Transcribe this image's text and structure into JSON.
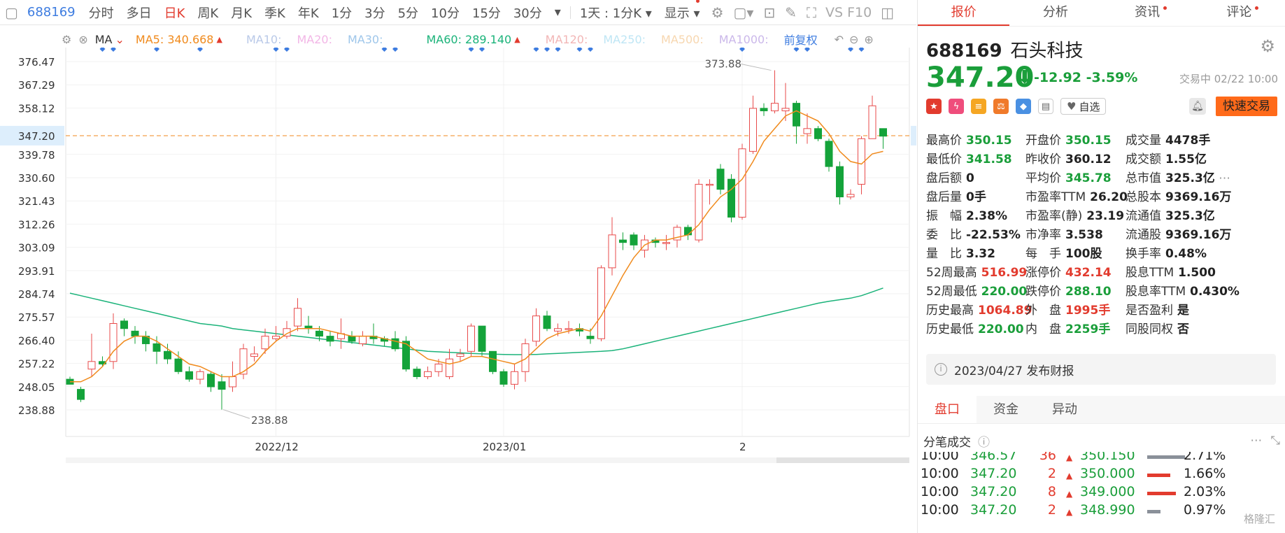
{
  "toolbar": {
    "code": "688169",
    "items": [
      "分时",
      "多日",
      "日K",
      "周K",
      "月K",
      "季K",
      "年K",
      "1分",
      "3分",
      "5分",
      "10分",
      "15分",
      "30分"
    ],
    "active": "日K",
    "range": "1天 : 1分K",
    "display": "显示",
    "vsf": "VS F10"
  },
  "ma": {
    "label": "MA",
    "ma5": "MA5: 340.668",
    "ma10": "MA10:",
    "ma20": "MA20:",
    "ma30": "MA30:",
    "ma60": "MA60: 289.140",
    "ma120": "MA120:",
    "ma250": "MA250:",
    "ma500": "MA500:",
    "ma1000": "MA1000:",
    "adjust": "前复权",
    "colors": {
      "ma5": "#f08a1c",
      "ma60": "#1bb37a",
      "faded": "#b9c9e8",
      "faded_red": "#f2b6b6"
    }
  },
  "chart_data": {
    "type": "candlestick",
    "y_ticks": [
      "376.47",
      "367.29",
      "358.12",
      "347.20",
      "339.78",
      "330.60",
      "321.43",
      "312.26",
      "303.09",
      "293.91",
      "284.74",
      "275.57",
      "266.40",
      "257.22",
      "248.05",
      "238.88"
    ],
    "current_price": "347.20",
    "x_labels": [
      "2022/12",
      "2023/01",
      "2"
    ],
    "high_label": "373.88",
    "low_label": "238.88",
    "candles": [
      [
        251,
        249,
        252,
        249
      ],
      [
        247,
        243,
        248,
        242
      ],
      [
        255,
        258,
        269,
        252
      ],
      [
        258,
        257,
        260,
        256
      ],
      [
        258,
        273,
        277,
        255
      ],
      [
        274,
        271,
        275,
        268
      ],
      [
        270,
        268,
        272,
        265
      ],
      [
        268,
        265,
        270,
        262
      ],
      [
        265,
        262,
        268,
        257
      ],
      [
        262,
        259,
        265,
        257
      ],
      [
        259,
        254,
        262,
        253
      ],
      [
        254,
        251,
        256,
        250
      ],
      [
        251,
        254,
        255,
        249
      ],
      [
        253,
        248,
        254,
        246
      ],
      [
        250,
        247,
        253,
        239
      ],
      [
        248,
        252,
        258,
        246
      ],
      [
        253,
        263,
        265,
        251
      ],
      [
        260,
        261,
        264,
        258
      ],
      [
        263,
        268,
        271,
        261
      ],
      [
        267,
        268,
        272,
        266
      ],
      [
        268,
        271,
        274,
        267
      ],
      [
        272,
        279,
        283,
        270
      ],
      [
        272,
        271,
        276,
        269
      ],
      [
        270,
        268,
        272,
        266
      ],
      [
        268,
        266,
        270,
        264
      ],
      [
        267,
        269,
        275,
        263
      ],
      [
        268,
        266,
        270,
        265
      ],
      [
        265,
        268,
        270,
        264
      ],
      [
        268,
        267,
        273,
        265
      ],
      [
        267,
        266,
        268,
        264
      ],
      [
        267,
        263,
        270,
        262
      ],
      [
        266,
        255,
        268,
        254
      ],
      [
        255,
        252,
        256,
        251
      ],
      [
        252,
        254,
        256,
        251
      ],
      [
        254,
        257,
        259,
        252
      ],
      [
        252,
        259,
        263,
        251
      ],
      [
        260,
        261,
        263,
        258
      ],
      [
        262,
        272,
        273,
        260
      ],
      [
        272,
        262,
        272,
        260
      ],
      [
        262,
        254,
        262,
        253
      ],
      [
        254,
        249,
        255,
        248
      ],
      [
        249,
        254,
        257,
        247
      ],
      [
        254,
        265,
        267,
        250
      ],
      [
        266,
        276,
        279,
        264
      ],
      [
        276,
        271,
        278,
        270
      ],
      [
        270,
        271,
        273,
        268
      ],
      [
        271,
        271,
        274,
        269
      ],
      [
        271,
        270,
        273,
        268
      ],
      [
        268,
        267,
        271,
        265
      ],
      [
        267,
        295,
        296,
        266
      ],
      [
        295,
        308,
        315,
        292
      ],
      [
        306,
        305,
        309,
        302
      ],
      [
        308,
        304,
        309,
        302
      ],
      [
        302,
        306,
        308,
        299
      ],
      [
        306,
        305,
        307,
        303
      ],
      [
        305,
        305,
        308,
        302
      ],
      [
        306,
        311,
        312,
        303
      ],
      [
        311,
        308,
        312,
        306
      ],
      [
        306,
        328,
        330,
        305
      ],
      [
        328,
        328,
        330,
        320
      ],
      [
        334,
        326,
        336,
        324
      ],
      [
        330,
        315,
        332,
        313
      ],
      [
        315,
        342,
        344,
        314
      ],
      [
        341,
        358,
        363,
        340
      ],
      [
        358,
        357,
        360,
        355
      ],
      [
        357,
        360,
        373,
        356
      ],
      [
        357,
        358,
        368,
        353
      ],
      [
        360,
        351,
        361,
        344
      ],
      [
        348,
        350,
        356,
        344
      ],
      [
        350,
        346,
        351,
        345
      ],
      [
        345,
        335,
        346,
        333
      ],
      [
        335,
        323,
        337,
        320
      ],
      [
        323,
        324,
        326,
        322
      ],
      [
        328,
        346,
        347,
        324
      ],
      [
        346,
        359,
        363,
        346
      ],
      [
        350,
        347,
        350,
        342
      ]
    ],
    "ma5": [
      250,
      250,
      252,
      256,
      262,
      266,
      268,
      268,
      266,
      263,
      260,
      257,
      256,
      254,
      252,
      252,
      254,
      257,
      262,
      266,
      269,
      271,
      271,
      271,
      270,
      269,
      268,
      268,
      268,
      267,
      266,
      265,
      262,
      259,
      258,
      257,
      258,
      260,
      260,
      259,
      258,
      257,
      259,
      263,
      267,
      269,
      270,
      271,
      270,
      276,
      284,
      292,
      299,
      304,
      306,
      306,
      307,
      308,
      312,
      318,
      323,
      326,
      330,
      337,
      345,
      350,
      355,
      357,
      355,
      353,
      348,
      341,
      337,
      336,
      340,
      341
    ],
    "ma60": [
      285,
      284,
      283,
      282,
      281,
      280,
      279,
      278,
      277,
      276,
      275,
      274,
      273,
      272.5,
      272,
      271,
      270.5,
      270,
      269.5,
      269,
      268.5,
      268,
      267.5,
      267,
      266.5,
      266,
      265.5,
      265,
      264.5,
      264,
      263.5,
      263,
      262.5,
      262,
      261.8,
      261.6,
      261.4,
      261.2,
      261,
      260.9,
      260.8,
      260.7,
      260.7,
      260.8,
      261,
      261.2,
      261.4,
      261.6,
      261.8,
      262,
      262.3,
      263,
      264,
      265,
      266,
      267,
      268,
      269,
      270,
      271,
      272,
      273,
      274,
      275,
      276,
      277,
      278,
      279,
      280,
      281,
      281.8,
      282.4,
      283,
      284,
      285.5,
      287
    ]
  },
  "quote": {
    "code": "688169",
    "name": "石头科技",
    "price": "347.20",
    "change": "-12.92",
    "pct": "-3.59%",
    "status": "交易中 02/22 10:00",
    "watch": "自选",
    "quick_trade": "快速交易",
    "rows": [
      [
        [
          "最高价",
          "350.15",
          "green"
        ],
        [
          "开盘价",
          "350.15",
          "green"
        ],
        [
          "成交量",
          "4478手",
          ""
        ]
      ],
      [
        [
          "最低价",
          "341.58",
          "green"
        ],
        [
          "昨收价",
          "360.12",
          ""
        ],
        [
          "成交额",
          "1.55亿",
          ""
        ]
      ],
      [
        [
          "盘后额",
          "0",
          ""
        ],
        [
          "平均价",
          "345.78",
          "green"
        ],
        [
          "总市值",
          "325.3亿",
          ""
        ]
      ],
      [
        [
          "盘后量",
          "0手",
          ""
        ],
        [
          "市盈率TTM",
          "26.20",
          ""
        ],
        [
          "总股本",
          "9369.16万",
          ""
        ]
      ],
      [
        [
          "振　幅",
          "2.38%",
          ""
        ],
        [
          "市盈率(静)",
          "23.19",
          ""
        ],
        [
          "流通值",
          "325.3亿",
          ""
        ]
      ],
      [
        [
          "委　比",
          "-22.53%",
          ""
        ],
        [
          "市净率",
          "3.538",
          ""
        ],
        [
          "流通股",
          "9369.16万",
          ""
        ]
      ],
      [
        [
          "量　比",
          "3.32",
          ""
        ],
        [
          "每　手",
          "100股",
          ""
        ],
        [
          "换手率",
          "0.48%",
          ""
        ]
      ],
      [
        [
          "52周最高",
          "516.99",
          "red"
        ],
        [
          "涨停价",
          "432.14",
          "red"
        ],
        [
          "股息TTM",
          "1.500",
          ""
        ]
      ],
      [
        [
          "52周最低",
          "220.00",
          "green"
        ],
        [
          "跌停价",
          "288.10",
          "green"
        ],
        [
          "股息率TTM",
          "0.430%",
          ""
        ]
      ],
      [
        [
          "历史最高",
          "1064.89",
          "red"
        ],
        [
          "外　盘",
          "1995手",
          "red"
        ],
        [
          "是否盈利",
          "是",
          ""
        ]
      ],
      [
        [
          "历史最低",
          "220.00",
          "green"
        ],
        [
          "内　盘",
          "2259手",
          "green"
        ],
        [
          "同股同权",
          "否",
          ""
        ]
      ]
    ],
    "report": "2023/04/27  发布财报"
  },
  "right_tabs": [
    "报价",
    "分析",
    "资讯",
    "评论"
  ],
  "sub_tabs": [
    "盘口",
    "资金",
    "异动"
  ],
  "ticks_title": "分笔成交",
  "ticks": [
    [
      "10:00",
      "346.57",
      "36",
      "350.150",
      "2.71%",
      "#8a9099"
    ],
    [
      "10:00",
      "347.20",
      "2",
      "350.000",
      "1.66%",
      "#e23b2e"
    ],
    [
      "10:00",
      "347.20",
      "8",
      "349.000",
      "2.03%",
      "#e23b2e"
    ],
    [
      "10:00",
      "347.20",
      "2",
      "348.990",
      "0.97%",
      "#8a9099"
    ]
  ],
  "watermark": "格隆汇"
}
